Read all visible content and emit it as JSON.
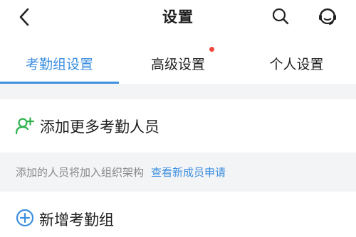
{
  "header": {
    "title": "设置",
    "back_icon": "chevron-left-icon",
    "search_icon": "search-icon",
    "support_icon": "customer-service-icon"
  },
  "tabs": [
    {
      "label": "考勤组设置",
      "active": true
    },
    {
      "label": "高级设置",
      "active": false,
      "badge_dot": true
    },
    {
      "label": "个人设置",
      "active": false
    }
  ],
  "add_members": {
    "label": "添加更多考勤人员",
    "icon": "add-user-icon"
  },
  "hint": {
    "text": "添加的人员将加入组织架构",
    "link": "查看新成员申请"
  },
  "new_group": {
    "label": "新增考勤组",
    "icon": "plus-circle-icon"
  },
  "colors": {
    "accent": "#3d8fe0",
    "green": "#2fb24c",
    "badge": "#f0473c",
    "background_gray": "#f3f4f6"
  }
}
